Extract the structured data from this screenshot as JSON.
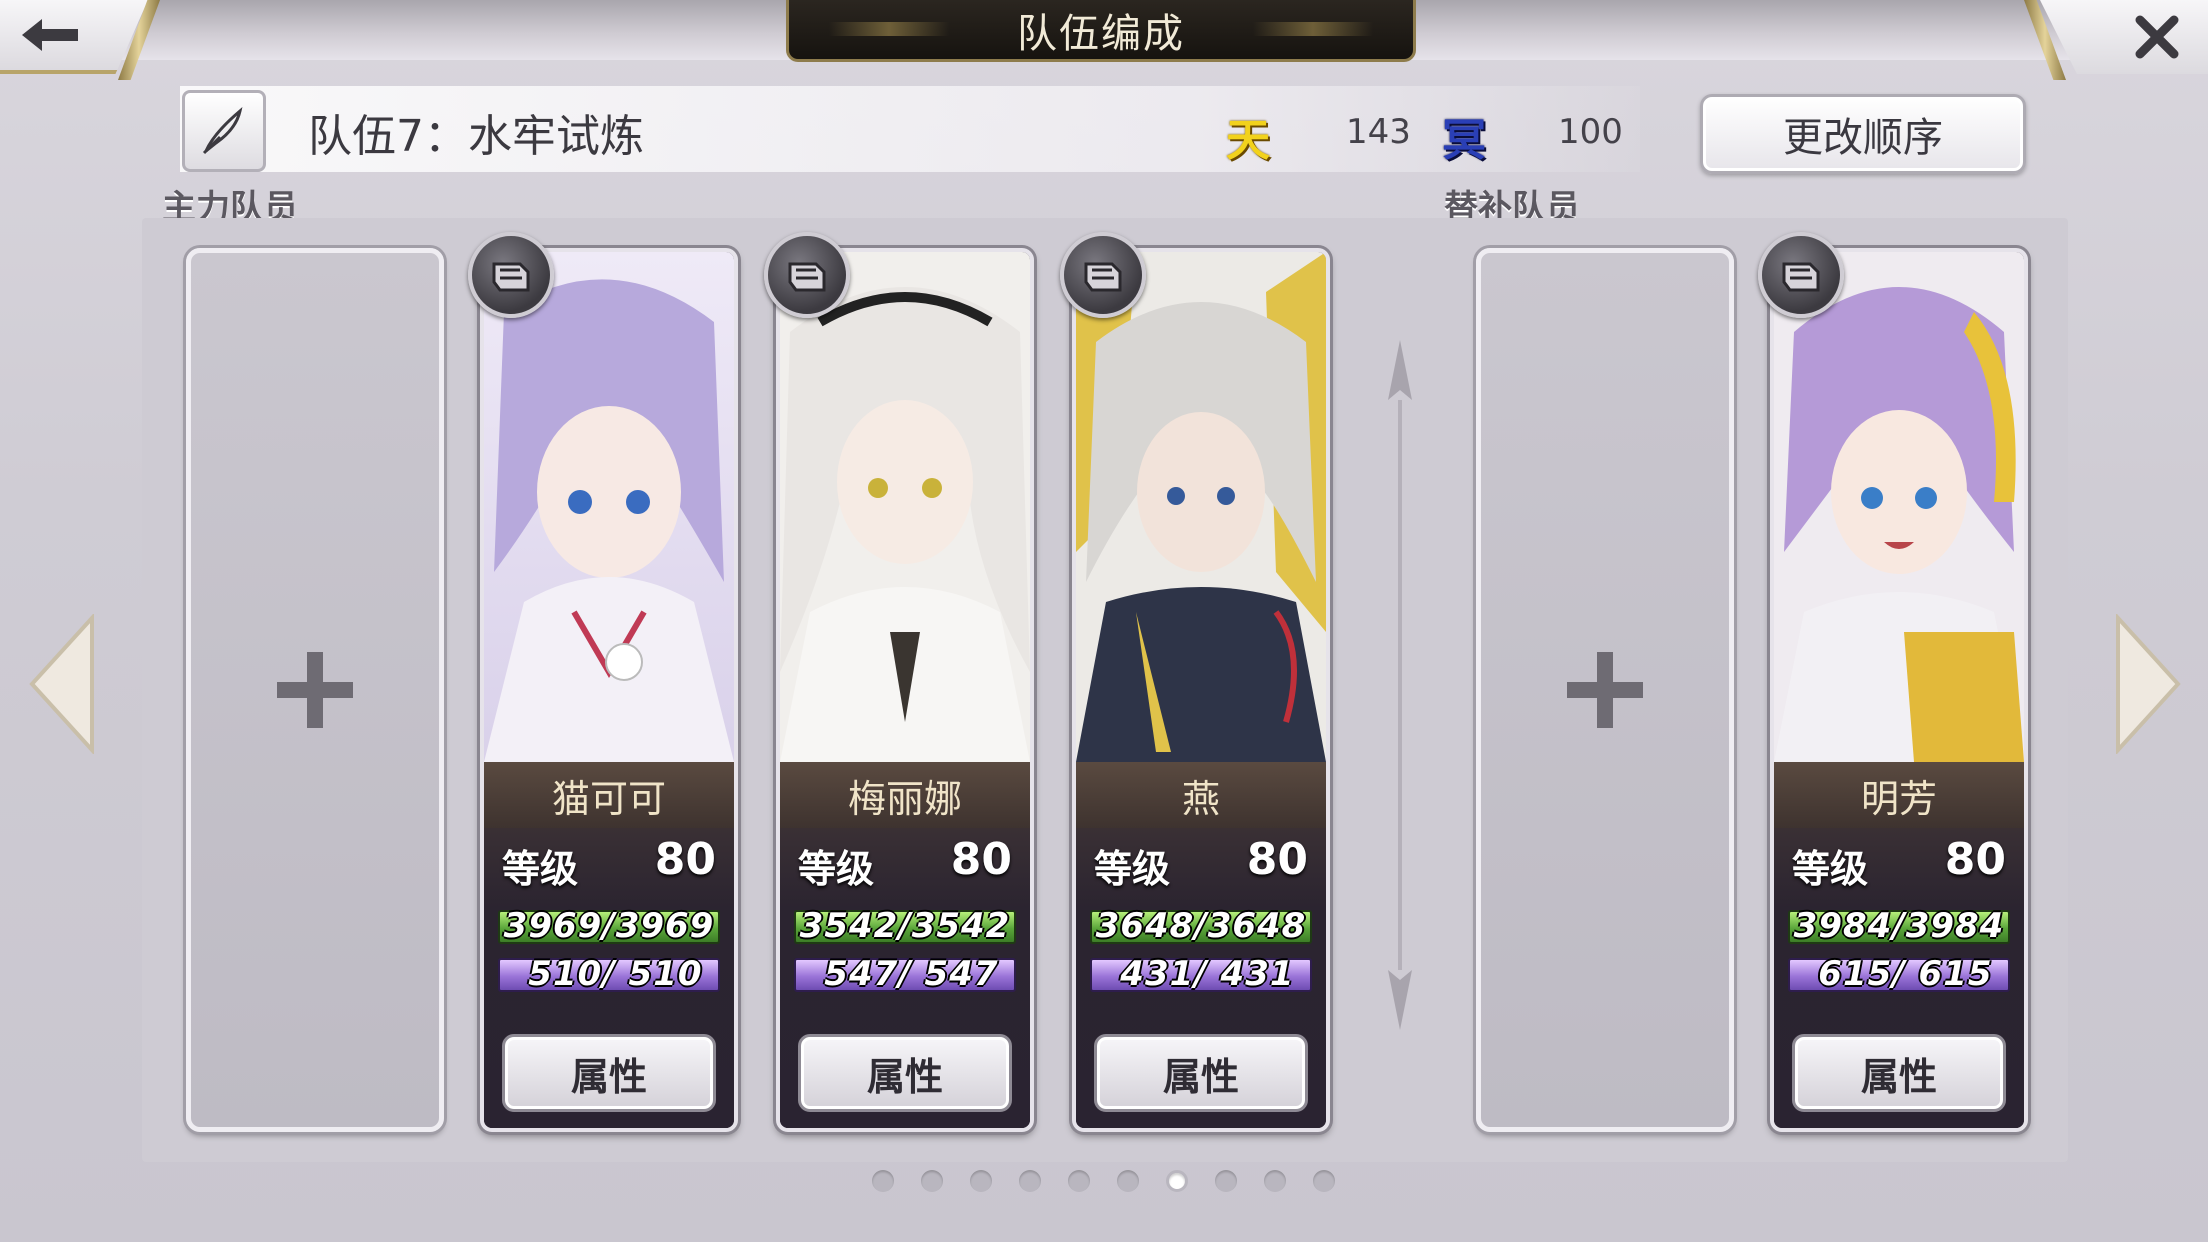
{
  "header": {
    "title": "队伍编成"
  },
  "team": {
    "name": "队伍7：水牢试炼",
    "heaven_icon": "天",
    "heaven_value": "143",
    "dark_icon": "冥",
    "dark_value": "100",
    "reorder_label": "更改顺序"
  },
  "sections": {
    "main_label": "主力队员",
    "sub_label": "替补队员"
  },
  "characters": [
    {
      "name": "猫可可",
      "level_label": "等级",
      "level": "80",
      "hp": "3969/3969",
      "mp": " 510/ 510",
      "attr_label": "属性",
      "weapon_icon": "gauntlet-icon",
      "theme": "#b7a9dc"
    },
    {
      "name": "梅丽娜",
      "level_label": "等级",
      "level": "80",
      "hp": "3542/3542",
      "mp": " 547/ 547",
      "attr_label": "属性",
      "weapon_icon": "gauntlet-icon",
      "theme": "#e9e6e3"
    },
    {
      "name": "燕",
      "level_label": "等级",
      "level": "80",
      "hp": "3648/3648",
      "mp": " 431/ 431",
      "attr_label": "属性",
      "weapon_icon": "gauntlet-icon",
      "theme": "#e0c24a"
    },
    {
      "name": "明芳",
      "level_label": "等级",
      "level": "80",
      "hp": "3984/3984",
      "mp": " 615/ 615",
      "attr_label": "属性",
      "weapon_icon": "gauntlet-icon",
      "theme": "#b59ad7"
    }
  ],
  "pagination": {
    "total": 10,
    "current": 7
  },
  "colors": {
    "heaven": "#f2d21c",
    "dark": "#2a3fb6",
    "hp_bar": "#5aa63a",
    "mp_bar": "#9a74d8"
  }
}
